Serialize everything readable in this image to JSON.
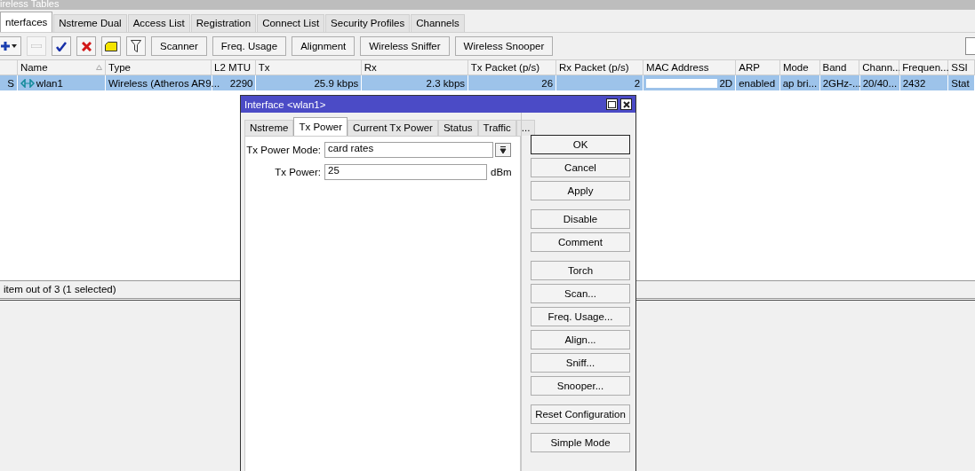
{
  "window": {
    "title": "ireless Tables"
  },
  "tabs": [
    {
      "label": "nterfaces",
      "selected": true
    },
    {
      "label": "Nstreme Dual",
      "selected": false
    },
    {
      "label": "Access List",
      "selected": false
    },
    {
      "label": "Registration",
      "selected": false
    },
    {
      "label": "Connect List",
      "selected": false
    },
    {
      "label": "Security Profiles",
      "selected": false
    },
    {
      "label": "Channels",
      "selected": false
    }
  ],
  "toolbar": {
    "icons": [
      {
        "kind": "add",
        "disabled": false
      },
      {
        "kind": "remove",
        "disabled": true
      },
      {
        "kind": "enable",
        "disabled": false
      },
      {
        "kind": "disable",
        "disabled": false
      },
      {
        "kind": "comment",
        "disabled": false
      },
      {
        "kind": "filter",
        "disabled": false
      }
    ],
    "buttons": [
      "Scanner",
      "Freq. Usage",
      "Alignment",
      "Wireless Sniffer",
      "Wireless Snooper"
    ]
  },
  "table": {
    "columns": [
      "Name",
      "Type",
      "L2 MTU",
      "Tx",
      "Rx",
      "Tx Packet (p/s)",
      "Rx Packet (p/s)",
      "MAC Address",
      "ARP",
      "Mode",
      "Band",
      "Chann...",
      "Frequen...",
      "SSI"
    ],
    "rows": [
      {
        "flags": "S",
        "selected": true,
        "mac_redacted": true,
        "cells": [
          "wlan1",
          "Wireless (Atheros AR9...",
          "2290",
          "25.9 kbps",
          "2.3 kbps",
          "26",
          "2",
          "2D",
          "enabled",
          "ap bri...",
          "2GHz-...",
          "20/40...",
          "2432",
          "Stat"
        ]
      }
    ]
  },
  "status_bar": "item out of 3 (1 selected)",
  "dialog": {
    "title": "Interface <wlan1>",
    "tabs": [
      {
        "label": "Nstreme",
        "selected": false
      },
      {
        "label": "Tx Power",
        "selected": true
      },
      {
        "label": "Current Tx Power",
        "selected": false
      },
      {
        "label": "Status",
        "selected": false
      },
      {
        "label": "Traffic",
        "selected": false
      },
      {
        "label": "...",
        "selected": false
      }
    ],
    "fields": [
      {
        "label": "Tx Power Mode:",
        "value": "card rates",
        "kind": "dropdown"
      },
      {
        "label": "Tx Power:",
        "value": "25",
        "kind": "text",
        "unit": "dBm"
      }
    ],
    "button_groups": [
      [
        {
          "label": "OK",
          "focused": true
        },
        {
          "label": "Cancel",
          "focused": false
        },
        {
          "label": "Apply",
          "focused": false
        }
      ],
      [
        {
          "label": "Disable",
          "focused": false
        },
        {
          "label": "Comment",
          "focused": false
        }
      ],
      [
        {
          "label": "Torch",
          "focused": false
        },
        {
          "label": "Scan...",
          "focused": false
        },
        {
          "label": "Freq. Usage...",
          "focused": false
        },
        {
          "label": "Align...",
          "focused": false
        },
        {
          "label": "Sniff...",
          "focused": false
        },
        {
          "label": "Snooper...",
          "focused": false
        }
      ],
      [
        {
          "label": "Reset Configuration",
          "focused": false
        }
      ],
      [
        {
          "label": "Simple Mode",
          "focused": false
        }
      ]
    ]
  }
}
